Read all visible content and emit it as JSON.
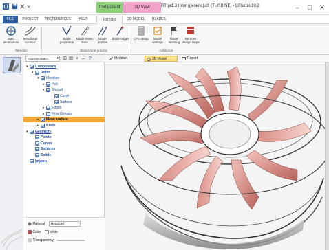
{
  "app": {
    "window_title": "RT pr1.3 rotor (generic).cft (TURBINE) - CFturbo 10.2",
    "context_tabs": [
      "Component",
      "3D View"
    ],
    "window_buttons": {
      "minimize": "–",
      "maximize": "□",
      "close": "✕"
    }
  },
  "ribbon_tabs": [
    {
      "label": "FILE"
    },
    {
      "label": "PROJECT"
    },
    {
      "label": "PREFERENCES"
    },
    {
      "label": "HELP"
    },
    {
      "label": "ROTOR"
    },
    {
      "label": "3D MODEL"
    },
    {
      "label": "BLADES"
    }
  ],
  "ribbon": {
    "buttons": [
      {
        "label": "Main dimensions",
        "icon": "main-dimensions-icon"
      },
      {
        "label": "Meridional contour",
        "icon": "meridional-contour-icon"
      },
      {
        "label": "Blade properties",
        "icon": "blade-properties-icon"
      },
      {
        "label": "Blade mean lines",
        "icon": "blade-mean-lines-icon"
      },
      {
        "label": "Blade profiles",
        "icon": "blade-profiles-icon"
      },
      {
        "label": "Blade edges",
        "icon": "blade-edges-icon"
      },
      {
        "label": "CFD setup",
        "icon": "cfd-setup-icon"
      },
      {
        "label": "Model settings",
        "icon": "model-settings-icon"
      },
      {
        "label": "Model finishing",
        "icon": "model-finishing-icon"
      },
      {
        "label": "Remove design steps",
        "icon": "remove-design-steps-icon"
      }
    ],
    "groups": [
      "Meridian",
      "Blade/Vane grading",
      "Additional"
    ]
  },
  "tree": {
    "state_select": "<current state>",
    "toolbar_buttons": [
      "⊞",
      "▥",
      "+",
      "–",
      "?"
    ],
    "rows": [
      {
        "label": "Components",
        "exp": "▾",
        "cb": true,
        "style": "bold blue under"
      },
      {
        "label": "Rotor",
        "exp": "▾",
        "cb": true,
        "style": "bold blue"
      },
      {
        "label": "Meridian",
        "exp": "▾",
        "cb": true,
        "style": "blue"
      },
      {
        "label": "Hub",
        "exp": "▸",
        "cb": true,
        "style": "blue"
      },
      {
        "label": "Shroud",
        "exp": "▾",
        "cb": true,
        "style": "blue"
      },
      {
        "label": "Curve",
        "exp": "",
        "cb": true,
        "style": "blue"
      },
      {
        "label": "Surface",
        "exp": "",
        "cb": true,
        "style": "blue"
      },
      {
        "label": "Edges",
        "exp": "▸",
        "cb": true,
        "style": "blue"
      },
      {
        "label": "Flow Domain",
        "exp": "▸",
        "cb": false,
        "style": "blue"
      },
      {
        "label": "Mean surface",
        "exp": "▸",
        "cb": true,
        "style": "hl"
      },
      {
        "label": "Blade",
        "exp": "▸",
        "cb": true,
        "style": "bold blue"
      },
      {
        "label": "Geometry",
        "exp": "▾",
        "cb": true,
        "style": "bold blue under"
      },
      {
        "label": "Points",
        "exp": "",
        "cb": true,
        "style": "bold blue"
      },
      {
        "label": "Curves",
        "exp": "",
        "cb": true,
        "style": "bold blue"
      },
      {
        "label": "Surfaces",
        "exp": "",
        "cb": true,
        "style": "bold blue"
      },
      {
        "label": "Solids",
        "exp": "",
        "cb": true,
        "style": "bold blue"
      },
      {
        "label": "Imports",
        "exp": "",
        "cb": true,
        "style": "bold blue under"
      }
    ]
  },
  "properties": {
    "material_label": "Material",
    "material_value": "Metalized",
    "color_label": "Color",
    "color_value": "white",
    "transparency_label": "Transparency"
  },
  "view_tabs": [
    {
      "label": "Meridian",
      "icon": "meridian-view-icon"
    },
    {
      "label": "3D Model",
      "icon": "3d-model-icon"
    },
    {
      "label": "Report",
      "icon": "report-icon"
    }
  ],
  "colors": {
    "accent": "#2f5f9e",
    "highlight": "#f2a93b",
    "blade": "#e8a39c",
    "component_tab": "#8fd17a",
    "view3d_tab": "#f2a3c8"
  }
}
